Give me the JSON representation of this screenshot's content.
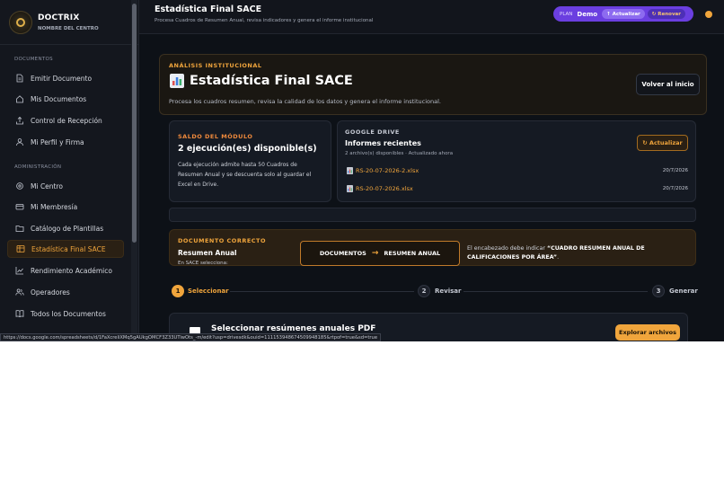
{
  "brand": {
    "name": "DOCTRIX",
    "subtitle": "NOMBRE DEL CENTRO"
  },
  "sidebar": {
    "sections": [
      {
        "title": "DOCUMENTOS",
        "items": [
          {
            "label": "Emitir Documento",
            "icon": "document-icon"
          },
          {
            "label": "Mis Documentos",
            "icon": "home-icon"
          },
          {
            "label": "Control de Recepción",
            "icon": "upload-icon"
          },
          {
            "label": "Mi Perfil y Firma",
            "icon": "user-icon"
          }
        ]
      },
      {
        "title": "ADMINISTRACIÓN",
        "items": [
          {
            "label": "Mi Centro",
            "icon": "settings-icon"
          },
          {
            "label": "Mi Membresía",
            "icon": "card-icon"
          },
          {
            "label": "Catálogo de Plantillas",
            "icon": "folder-icon"
          },
          {
            "label": "Estadística Final SACE",
            "icon": "spreadsheet-icon",
            "active": true
          },
          {
            "label": "Rendimiento Académico",
            "icon": "chart-icon"
          },
          {
            "label": "Operadores",
            "icon": "users-icon"
          },
          {
            "label": "Todos los Documentos",
            "icon": "book-icon"
          }
        ]
      }
    ]
  },
  "topbar": {
    "title": "Estadística Final SACE",
    "subtitle": "Procesa Cuadros de Resumen Anual, revisa indicadores y genera el informe institucional",
    "plan": {
      "label": "PLAN",
      "name": "Demo",
      "update": "↑ Actualizar",
      "renew": "↻ Renovar"
    }
  },
  "hero": {
    "kicker": "ANÁLISIS INSTITUCIONAL",
    "title": "Estadística Final SACE",
    "subtitle": "Procesa los cuadros resumen, revisa la calidad de los datos y genera el informe institucional.",
    "home_button": "Volver al inicio"
  },
  "saldo": {
    "kicker": "SALDO DEL MÓDULO",
    "headline": "2 ejecución(es) disponible(s)",
    "description": "Cada ejecución admite hasta 50 Cuadros de Resumen Anual y se descuenta solo al guardar el Excel en Drive."
  },
  "drive": {
    "kicker": "GOOGLE DRIVE",
    "title": "Informes recientes",
    "subtitle": "2 archivo(s) disponibles · Actualizado ahora",
    "refresh": "↻ Actualizar",
    "files": [
      {
        "name": "RS-20-07-2026-2.xlsx",
        "date": "20/7/2026"
      },
      {
        "name": "RS-20-07-2026.xlsx",
        "date": "20/7/2026"
      }
    ]
  },
  "doc": {
    "kicker": "DOCUMENTO CORRECTO",
    "title": "Resumen Anual",
    "subtitle": "En SACE selecciona:",
    "flow_from": "DOCUMENTOS",
    "flow_arrow": "→",
    "flow_to": "RESUMEN ANUAL",
    "note_prefix": "El encabezado debe indicar ",
    "note_bold": "“CUADRO RESUMEN ANUAL DE CALIFICACIONES POR ÁREA”",
    "note_suffix": "."
  },
  "steps": [
    {
      "num": "1",
      "label": "Seleccionar",
      "active": true
    },
    {
      "num": "2",
      "label": "Revisar",
      "active": false
    },
    {
      "num": "3",
      "label": "Generar",
      "active": false
    }
  ],
  "upload": {
    "title": "Seleccionar resúmenes anuales PDF",
    "button": "Explorar archivos"
  },
  "status_url": "https://docs.google.com/spreadsheets/d/1FaXcreliXMq5gAUkgOMCF3Z33UTiwOts_-m/edit?usp=drivesdk&ouid=111153948674509948185&rtpof=true&sd=true",
  "colors": {
    "accent": "#f0a53c",
    "plan": "#6b3fe0",
    "bg": "#0d1117"
  }
}
